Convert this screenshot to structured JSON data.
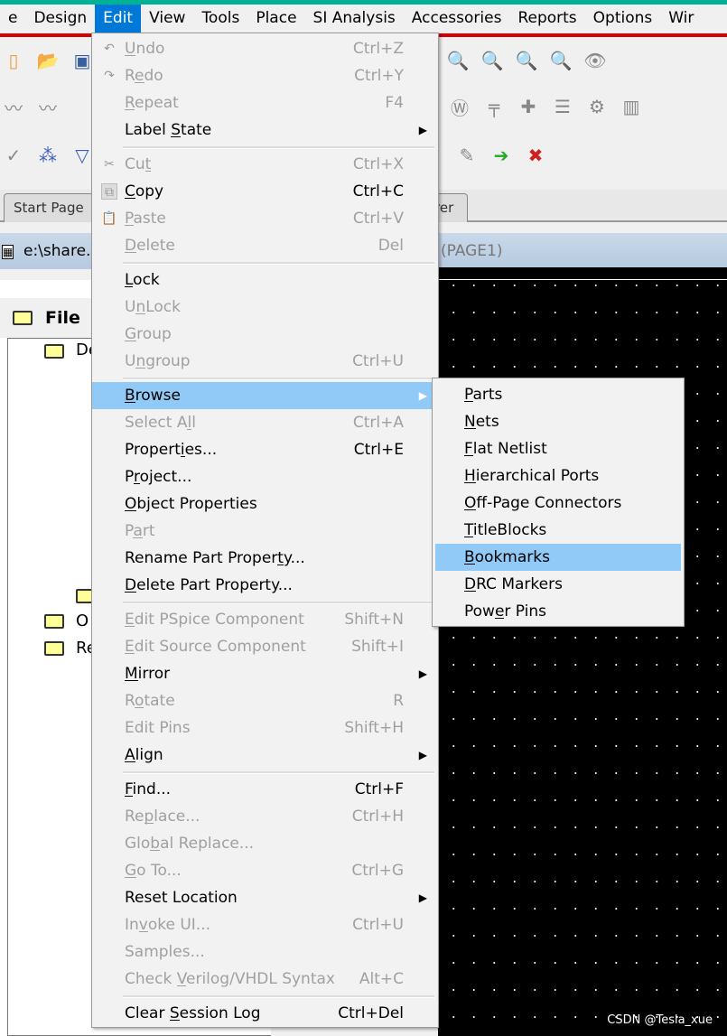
{
  "menubar": {
    "items": [
      "e",
      "Design",
      "Edit",
      "View",
      "Tools",
      "Place",
      "SI Analysis",
      "Accessories",
      "Reports",
      "Options",
      "Wir"
    ],
    "active": "Edit"
  },
  "tabs": {
    "start_page": "Start Page",
    "partial_tab": "rer"
  },
  "window": {
    "title_left": "e:\\share.",
    "title_right": "(PAGE1)"
  },
  "panel": {
    "header": "File",
    "tree": [
      "De",
      "O",
      "Re"
    ]
  },
  "edit_menu": [
    {
      "label": "Undo",
      "m": 0,
      "shortcut": "Ctrl+Z",
      "disabled": true,
      "icon": "undo-icon"
    },
    {
      "label": "Redo",
      "m": 1,
      "shortcut": "Ctrl+Y",
      "disabled": true,
      "icon": "redo-icon"
    },
    {
      "label": "Repeat",
      "m": 0,
      "shortcut": "F4",
      "disabled": true
    },
    {
      "label": "Label State",
      "m": 6,
      "submenu": true
    },
    {
      "sep": true
    },
    {
      "label": "Cut",
      "m": 2,
      "shortcut": "Ctrl+X",
      "disabled": true,
      "icon": "cut-icon"
    },
    {
      "label": "Copy",
      "m": 0,
      "shortcut": "Ctrl+C",
      "icon": "copy-icon"
    },
    {
      "label": "Paste",
      "m": 0,
      "shortcut": "Ctrl+V",
      "disabled": true,
      "icon": "paste-icon"
    },
    {
      "label": "Delete",
      "m": 0,
      "shortcut": "Del",
      "disabled": true
    },
    {
      "sep": true
    },
    {
      "label": "Lock",
      "m": 0
    },
    {
      "label": "UnLock",
      "m": 1,
      "disabled": true
    },
    {
      "label": "Group",
      "m": 0,
      "disabled": true
    },
    {
      "label": "Ungroup",
      "m": 1,
      "shortcut": "Ctrl+U",
      "disabled": true
    },
    {
      "sep": true
    },
    {
      "label": "Browse",
      "m": 0,
      "submenu": true,
      "highlighted": true
    },
    {
      "label": "Select All",
      "m": 8,
      "shortcut": "Ctrl+A",
      "disabled": true
    },
    {
      "label": "Properties...",
      "m": 7,
      "shortcut": "Ctrl+E"
    },
    {
      "label": "Project...",
      "m": 1
    },
    {
      "label": "Object Properties",
      "m": 0
    },
    {
      "label": "Part",
      "m": 1,
      "disabled": true
    },
    {
      "label": "Rename Part Property...",
      "m": 18
    },
    {
      "label": "Delete Part Property...",
      "m": 0
    },
    {
      "sep": true
    },
    {
      "label": "Edit PSpice Component",
      "m": 0,
      "shortcut": "Shift+N",
      "disabled": true
    },
    {
      "label": "Edit Source Component",
      "m": 0,
      "shortcut": "Shift+I",
      "disabled": true
    },
    {
      "label": "Mirror",
      "m": 0,
      "submenu": true
    },
    {
      "label": "Rotate",
      "m": 1,
      "shortcut": "R",
      "disabled": true
    },
    {
      "label": "Edit Pins",
      "m": -1,
      "shortcut": "Shift+H",
      "disabled": true
    },
    {
      "label": "Align",
      "m": 0,
      "submenu": true
    },
    {
      "sep": true
    },
    {
      "label": "Find...",
      "m": 0,
      "shortcut": "Ctrl+F"
    },
    {
      "label": "Replace...",
      "m": 2,
      "shortcut": "Ctrl+H",
      "disabled": true
    },
    {
      "label": "Global Replace...",
      "m": 3,
      "disabled": true
    },
    {
      "label": "Go To...",
      "m": 0,
      "shortcut": "Ctrl+G",
      "disabled": true
    },
    {
      "label": "Reset Location",
      "m": -1,
      "submenu": true
    },
    {
      "label": "Invoke UI...",
      "m": 2,
      "shortcut": "Ctrl+U",
      "disabled": true
    },
    {
      "label": "Samples...",
      "m": -1,
      "disabled": true
    },
    {
      "label": "Check Verilog/VHDL Syntax",
      "m": 6,
      "shortcut": "Alt+C",
      "disabled": true
    },
    {
      "sep": true
    },
    {
      "label": "Clear Session Log",
      "m": 6,
      "shortcut": "Ctrl+Del"
    }
  ],
  "browse_submenu": [
    {
      "label": "Parts",
      "m": 0
    },
    {
      "label": "Nets",
      "m": 0
    },
    {
      "label": "Flat Netlist",
      "m": 0
    },
    {
      "label": "Hierarchical Ports",
      "m": 0
    },
    {
      "label": "Off-Page Connectors",
      "m": 0
    },
    {
      "label": "TitleBlocks",
      "m": 0
    },
    {
      "label": "Bookmarks",
      "m": 0,
      "highlighted": true
    },
    {
      "label": "DRC Markers",
      "m": 0
    },
    {
      "label": "Power Pins",
      "m": 3
    }
  ],
  "watermark": "CSDN @Tesla_xue",
  "colors": {
    "highlight": "#91c9f7",
    "menubar_active": "#0078d7",
    "accent_strip": "#00b294",
    "red_line": "#d60000"
  }
}
